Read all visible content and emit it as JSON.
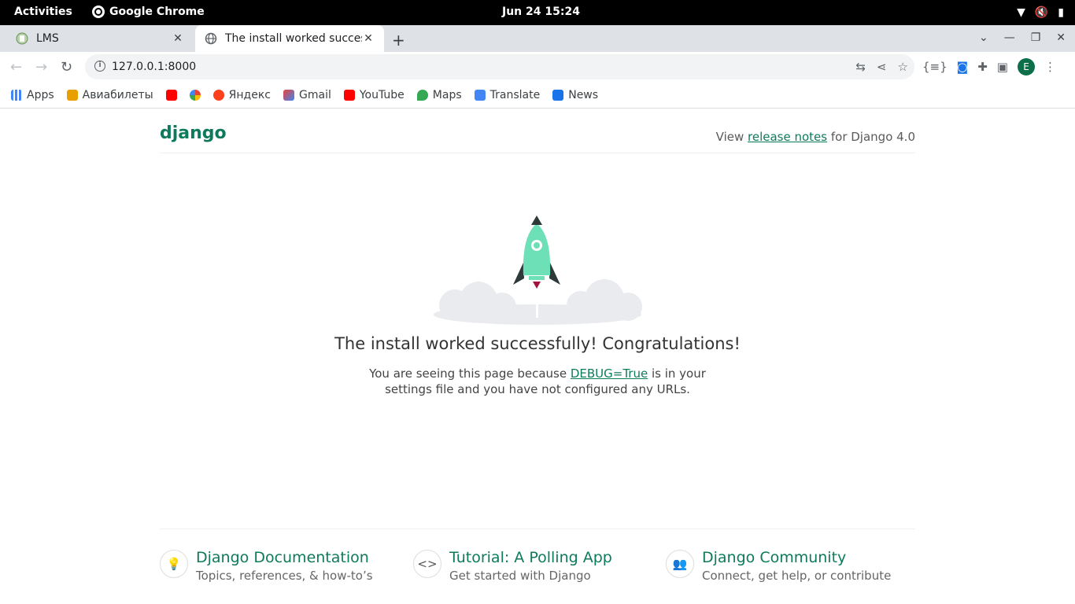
{
  "os_bar": {
    "activities": "Activities",
    "app_name": "Google Chrome",
    "clock": "Jun 24  15:24"
  },
  "tabs": [
    {
      "title": "LMS",
      "active": false
    },
    {
      "title": "The install worked successfully! Congratulations!",
      "active": true
    }
  ],
  "toolbar": {
    "url": "127.0.0.1:8000",
    "avatar_letter": "E"
  },
  "bookmarks": [
    {
      "label": "Apps",
      "color": "#4285f4"
    },
    {
      "label": "Авиабилеты",
      "color": "#e8a000"
    },
    {
      "label": "",
      "color": "#ff0000"
    },
    {
      "label": "",
      "color": "#4285f4"
    },
    {
      "label": "Яндекс",
      "color": "#fc3f1d"
    },
    {
      "label": "Gmail",
      "color": "#ea4335"
    },
    {
      "label": "YouTube",
      "color": "#ff0000"
    },
    {
      "label": "Maps",
      "color": "#34a853"
    },
    {
      "label": "Translate",
      "color": "#4285f4"
    },
    {
      "label": "News",
      "color": "#1a73e8"
    }
  ],
  "page": {
    "logo": "django",
    "notes_prefix": "View ",
    "notes_link": "release notes",
    "notes_suffix": " for Django 4.0",
    "headline": "The install worked successfully! Congratulations!",
    "sub_prefix": "You are seeing this page because ",
    "sub_link": "DEBUG=True",
    "sub_suffix": " is in your settings file and you have not configured any URLs.",
    "cards": [
      {
        "title": "Django Documentation",
        "subtitle": "Topics, references, & how-to’s",
        "icon": "lightbulb-icon"
      },
      {
        "title": "Tutorial: A Polling App",
        "subtitle": "Get started with Django",
        "icon": "code-icon"
      },
      {
        "title": "Django Community",
        "subtitle": "Connect, get help, or contribute",
        "icon": "people-icon"
      }
    ]
  }
}
